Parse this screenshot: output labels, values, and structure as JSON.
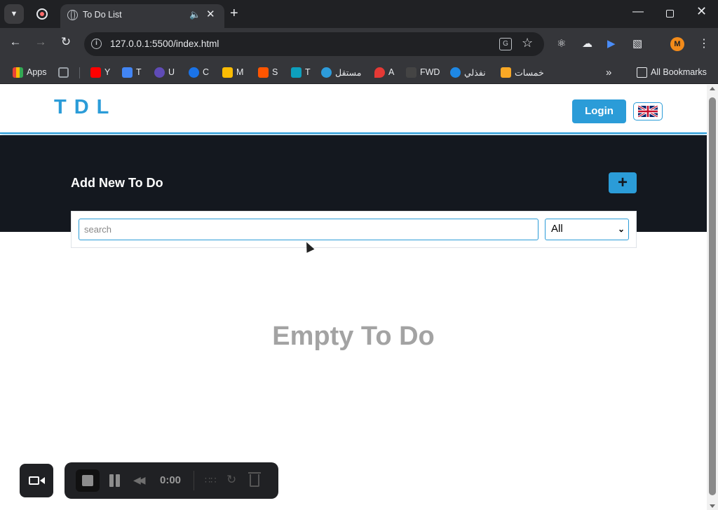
{
  "browser": {
    "tab": {
      "title": "To Do List"
    },
    "url": "127.0.0.1:5500/index.html",
    "profile_initial": "M",
    "bookmarks": [
      {
        "label": "Apps",
        "color": "#ea4335"
      },
      {
        "label": "",
        "color": "#9aa0a6"
      },
      {
        "label": "Y",
        "color": "#ff0000"
      },
      {
        "label": "T",
        "color": "#4285f4"
      },
      {
        "label": "U",
        "color": "#5f4bb6"
      },
      {
        "label": "C",
        "color": "#1a73e8"
      },
      {
        "label": "M",
        "color": "#fbbc04"
      },
      {
        "label": "S",
        "color": "#ff5500"
      },
      {
        "label": "T",
        "color": "#0d9fbd"
      },
      {
        "label": "مستقل",
        "color": "#2d9cdb"
      },
      {
        "label": "A",
        "color": "#e53935"
      },
      {
        "label": "FWD",
        "color": "#444444"
      },
      {
        "label": "نفذلي",
        "color": "#1e88e5"
      },
      {
        "label": "خمسات",
        "color": "#f9a825"
      }
    ],
    "all_bookmarks": "All Bookmarks"
  },
  "site": {
    "logo": "TDL",
    "login_label": "Login",
    "language_flag": "uk-flag-icon",
    "add_title": "Add New To Do",
    "add_button": "+",
    "search": {
      "placeholder": "search",
      "value": ""
    },
    "filter": {
      "selected": "All"
    },
    "empty_message": "Empty To Do"
  },
  "recorder": {
    "time": "0:00"
  },
  "colors": {
    "accent": "#2b9cd8",
    "dark_band": "#14181f",
    "empty_text": "#a3a3a3"
  }
}
